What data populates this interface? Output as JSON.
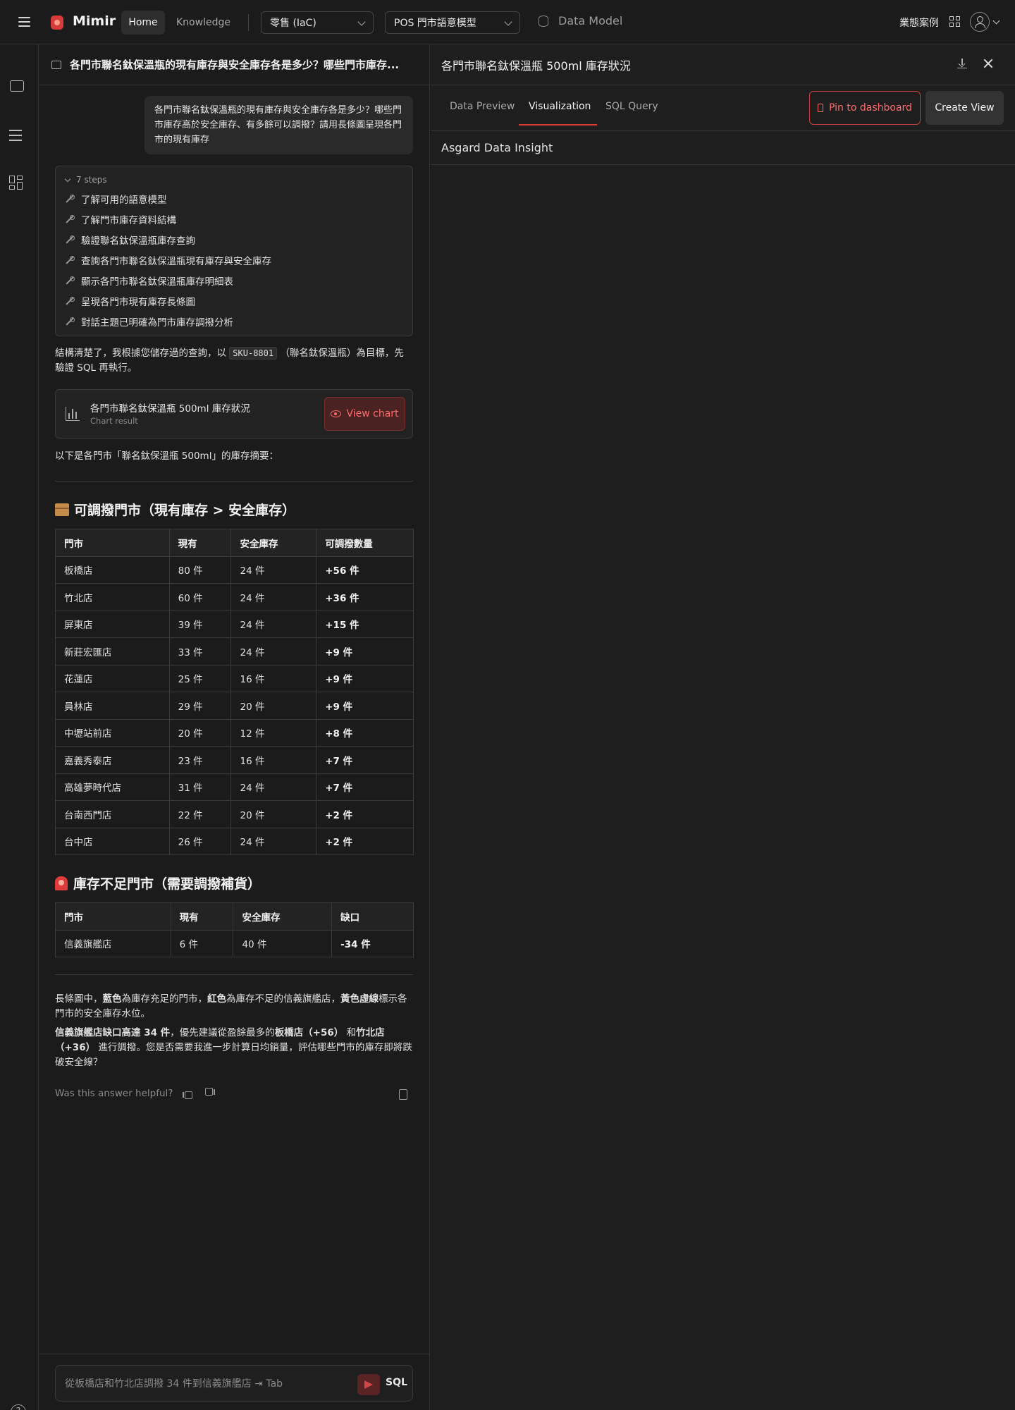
{
  "topbar": {
    "app_name": "Mimir",
    "nav_home": "Home",
    "nav_knowledge": "Knowledge",
    "workspace_select": "零售 (IaC)",
    "model_select": "POS 門市語意模型",
    "data_model": "Data Model",
    "use_cases": "業態案例"
  },
  "chat": {
    "title": "各門市聯名鈦保溫瓶的現有庫存與安全庫存各是多少？哪些門市庫存...",
    "user_message": "各門市聯名鈦保溫瓶的現有庫存與安全庫存各是多少？哪些門市庫存高於安全庫存、有多餘可以調撥？請用長條圖呈現各門市的現有庫存",
    "steps_label": "7 steps",
    "steps": [
      "了解可用的語意模型",
      "了解門市庫存資料結構",
      "驗證聯名鈦保溫瓶庫存查詢",
      "查詢各門市聯名鈦保溫瓶現有庫存與安全庫存",
      "顯示各門市聯名鈦保溫瓶庫存明細表",
      "呈現各門市現有庫存長條圖",
      "對話主題已明確為門市庫存調撥分析"
    ],
    "intro_before": "結構清楚了，我根據您儲存過的查詢，以",
    "intro_code": "SKU-8801",
    "intro_after": "（聯名鈦保溫瓶）為目標，先驗證 SQL 再執行。",
    "chart_card": {
      "title": "各門市聯名鈦保溫瓶 500ml 庫存狀況",
      "subtitle": "Chart result",
      "button": "View chart"
    },
    "summary_intro": "以下是各門市「聯名鈦保溫瓶 500ml」的庫存摘要：",
    "surplus_heading": "可調撥門市（現有庫存 > 安全庫存）",
    "surplus_table": {
      "headers": [
        "門市",
        "現有",
        "安全庫存",
        "可調撥數量"
      ],
      "rows": [
        [
          "板橋店",
          "80 件",
          "24 件",
          "+56 件"
        ],
        [
          "竹北店",
          "60 件",
          "24 件",
          "+36 件"
        ],
        [
          "屏東店",
          "39 件",
          "24 件",
          "+15 件"
        ],
        [
          "新莊宏匯店",
          "33 件",
          "24 件",
          "+9 件"
        ],
        [
          "花蓮店",
          "25 件",
          "16 件",
          "+9 件"
        ],
        [
          "員林店",
          "29 件",
          "20 件",
          "+9 件"
        ],
        [
          "中壢站前店",
          "20 件",
          "12 件",
          "+8 件"
        ],
        [
          "嘉義秀泰店",
          "23 件",
          "16 件",
          "+7 件"
        ],
        [
          "高雄夢時代店",
          "31 件",
          "24 件",
          "+7 件"
        ],
        [
          "台南西門店",
          "22 件",
          "20 件",
          "+2 件"
        ],
        [
          "台中店",
          "26 件",
          "24 件",
          "+2 件"
        ]
      ]
    },
    "shortage_heading": "庫存不足門市（需要調撥補貨）",
    "shortage_table": {
      "headers": [
        "門市",
        "現有",
        "安全庫存",
        "缺口"
      ],
      "rows": [
        [
          "信義旗艦店",
          "6 件",
          "40 件",
          "-34 件"
        ]
      ]
    },
    "legend_note": {
      "t1": "長條圖中，",
      "b1": "藍色",
      "t2": "為庫存充足的門市，",
      "b2": "紅色",
      "t3": "為庫存不足的信義旗艦店，",
      "b3": "黃色虛線",
      "t4": "標示各門市的安全庫存水位。"
    },
    "recommendation": {
      "b1": "信義旗艦店缺口高達 34 件",
      "t1": "，優先建議從盈餘最多的",
      "b2": "板橋店（+56）",
      "t2": " 和",
      "b3": "竹北店（+36）",
      "t3": " 進行調撥。您是否需要我進一步計算日均銷量，評估哪些門市的庫存即將跌破安全線？"
    },
    "helpful": "Was this answer helpful?",
    "input_placeholder": "從板橋店和竹北店調撥 34 件到信義旗艦店 ⇥ Tab",
    "sql_label": "SQL"
  },
  "right_panel": {
    "title": "各門市聯名鈦保溫瓶 500ml 庫存狀況",
    "tabs": [
      "Data Preview",
      "Visualization",
      "SQL Query"
    ],
    "active_tab": "Visualization",
    "pin_button": "Pin to dashboard",
    "create_button": "Create View",
    "insight_label": "Asgard Data Insight"
  },
  "colors": {
    "accent": "#e03a3a",
    "background": "#1b1b1b",
    "panel": "#1e1e1e"
  }
}
